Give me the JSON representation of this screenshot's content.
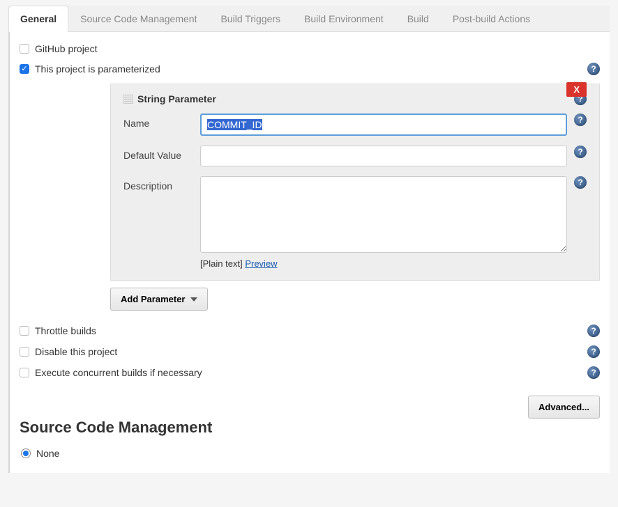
{
  "tabs": [
    {
      "label": "General",
      "active": true
    },
    {
      "label": "Source Code Management",
      "active": false
    },
    {
      "label": "Build Triggers",
      "active": false
    },
    {
      "label": "Build Environment",
      "active": false
    },
    {
      "label": "Build",
      "active": false
    },
    {
      "label": "Post-build Actions",
      "active": false
    }
  ],
  "general": {
    "github_project": {
      "label": "GitHub project",
      "checked": false
    },
    "parameterized": {
      "label": "This project is parameterized",
      "checked": true
    },
    "throttle": {
      "label": "Throttle builds",
      "checked": false
    },
    "disable": {
      "label": "Disable this project",
      "checked": false
    },
    "concurrent": {
      "label": "Execute concurrent builds if necessary",
      "checked": false
    },
    "advanced_button": "Advanced..."
  },
  "parameter": {
    "type_title": "String Parameter",
    "close": "X",
    "name": {
      "label": "Name",
      "value": "COMMIT_ID"
    },
    "default": {
      "label": "Default Value",
      "value": ""
    },
    "description": {
      "label": "Description",
      "value": ""
    },
    "plain_text": "[Plain text]",
    "preview": "Preview",
    "add_button": "Add Parameter"
  },
  "scm": {
    "heading": "Source Code Management",
    "none": {
      "label": "None",
      "checked": true
    }
  },
  "help_glyph": "?"
}
